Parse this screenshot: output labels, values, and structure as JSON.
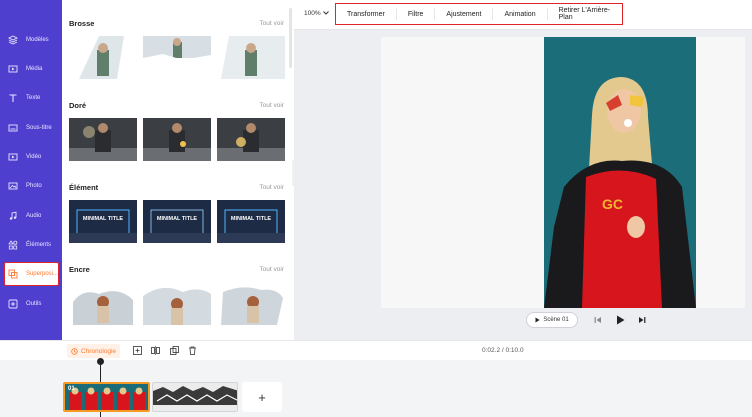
{
  "sidebar": {
    "items": [
      {
        "label": "Modèles",
        "icon": "layers-icon"
      },
      {
        "label": "Média",
        "icon": "media-icon"
      },
      {
        "label": "Texte",
        "icon": "text-icon"
      },
      {
        "label": "Sous-titre",
        "icon": "subtitle-icon"
      },
      {
        "label": "Vidéo",
        "icon": "video-icon"
      },
      {
        "label": "Photo",
        "icon": "photo-icon"
      },
      {
        "label": "Audio",
        "icon": "audio-icon"
      },
      {
        "label": "Éléments",
        "icon": "elements-icon"
      },
      {
        "label": "Superposi...",
        "icon": "overlay-icon",
        "active": true
      },
      {
        "label": "Outils",
        "icon": "tools-icon"
      }
    ]
  },
  "panel": {
    "sections": [
      {
        "title": "Brosse",
        "more": "Tout voir"
      },
      {
        "title": "Doré",
        "more": "Tout voir"
      },
      {
        "title": "Élément",
        "more": "Tout voir",
        "thumb_text": "MINIMAL TITLE"
      },
      {
        "title": "Encre",
        "more": "Tout voir"
      }
    ]
  },
  "toolbar": {
    "zoom": "100%",
    "tools": [
      "Transformer",
      "Filtre",
      "Ajustement",
      "Animation",
      "Retirer L'Arrière-Plan"
    ]
  },
  "preview": {
    "scene_label": "Scène 01"
  },
  "timeline": {
    "chronologie_label": "Chronologie",
    "time_display": "0:02.2 / 0:10.0",
    "clip1_number": "01",
    "add_symbol": "+"
  },
  "colors": {
    "sidebar_bg": "#4f3fcf",
    "accent_orange": "#ff7a2f",
    "highlight_red": "#e0222a",
    "clip_selected_border": "#f59a23"
  }
}
